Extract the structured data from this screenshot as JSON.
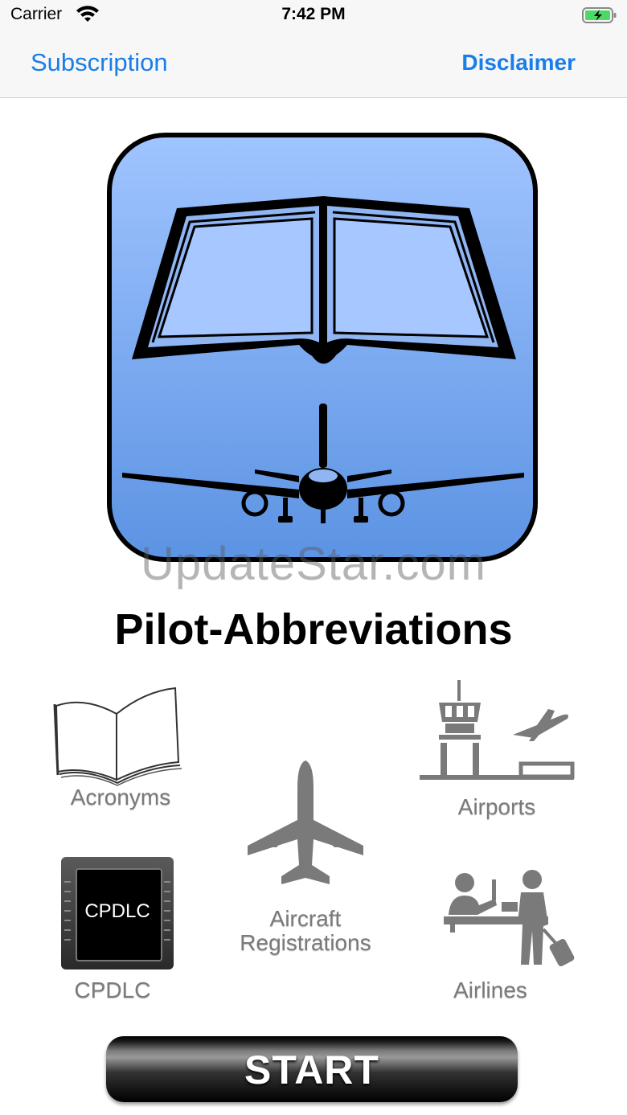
{
  "status_bar": {
    "carrier": "Carrier",
    "time": "7:42 PM"
  },
  "nav": {
    "left_label": "Subscription",
    "right_label": "Disclaimer"
  },
  "watermark": "UpdateStar.com",
  "app_title": "Pilot-Abbreviations",
  "tiles": [
    {
      "label": "Acronyms",
      "icon": "open-book-icon"
    },
    {
      "label": "Airports",
      "icon": "control-tower-icon"
    },
    {
      "label": "Aircraft\nRegistrations",
      "icon": "airplane-icon"
    },
    {
      "label": "CPDLC",
      "icon": "cpdlc-screen-icon",
      "screen_text": "CPDLC"
    },
    {
      "label": "Airlines",
      "icon": "check-in-counter-icon"
    }
  ],
  "start_button": {
    "label": "START"
  },
  "colors": {
    "accent": "#1a7ee8",
    "icon_bg_top": "#a0c4ff",
    "icon_bg_bottom": "#5c93e3",
    "tile_gray": "#7a7a7a"
  }
}
